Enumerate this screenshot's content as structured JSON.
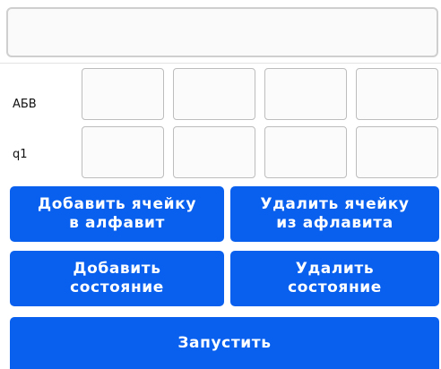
{
  "tape": {
    "value": "",
    "placeholder": ""
  },
  "alphabet_row": {
    "label": "АБВ",
    "cells": [
      "",
      "",
      "",
      ""
    ]
  },
  "state_row": {
    "label": "q1",
    "cells": [
      "",
      "",
      "",
      ""
    ]
  },
  "buttons": {
    "add_cell": {
      "line1": "Добавить ячейку",
      "line2": "в алфавит"
    },
    "remove_cell": {
      "line1": "Удалить ячейку",
      "line2": "из афлавита"
    },
    "add_state": {
      "line1": "Добавить",
      "line2": "состояние"
    },
    "remove_state": {
      "line1": "Удалить",
      "line2": "состояние"
    },
    "run": "Запустить"
  },
  "colors": {
    "accent": "#0a60ee",
    "cell_border": "#bdbdbd",
    "background": "#ffffff"
  }
}
